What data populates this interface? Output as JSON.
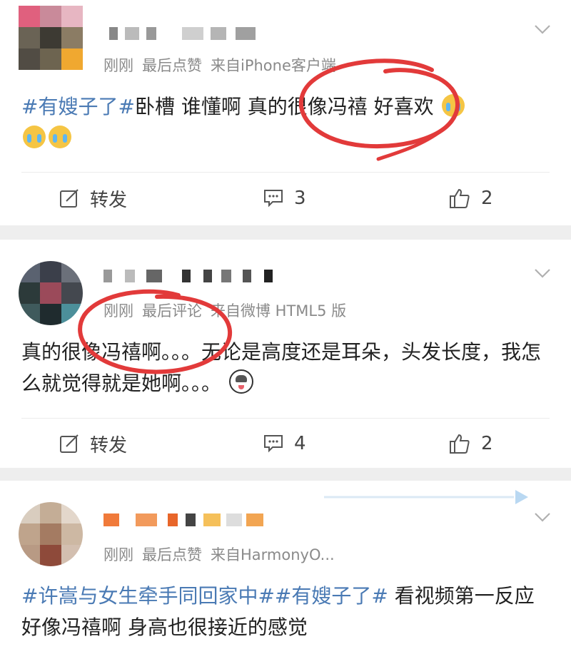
{
  "posts": [
    {
      "meta": {
        "time": "刚刚",
        "liked": "最后点赞",
        "source": "来自iPhone客户端"
      },
      "content": {
        "tag": "#有嫂子了#",
        "text": "卧槽 谁懂啊 真的很像冯禧 好喜欢"
      },
      "actions": {
        "repost": "转发",
        "comments": "3",
        "likes": "2"
      }
    },
    {
      "meta": {
        "time": "刚刚",
        "liked": "最后评论",
        "source": "来自微博 HTML5 版"
      },
      "content": {
        "text": "真的很像冯禧啊。。。无论是高度还是耳朵，头发长度，我怎么就觉得就是她啊。。。"
      },
      "actions": {
        "repost": "转发",
        "comments": "4",
        "likes": "2"
      }
    },
    {
      "meta": {
        "time": "刚刚",
        "liked": "最后点赞",
        "source": "来自HarmonyO..."
      },
      "content": {
        "tag": "#许嵩与女生牵手同回家中##有嫂子了#",
        "text": " 看视频第一反应 好像冯禧啊 身高也很接近的感觉"
      }
    }
  ],
  "icons": {
    "repost": "edit-square-icon",
    "comment": "comment-bubble-icon",
    "like": "thumbs-up-icon",
    "more": "chevron-down-icon"
  },
  "colors": {
    "hashtag": "#4a7ab4",
    "meta": "#8a8a8a",
    "annotation": "#e23a3a",
    "separator": "#eeeeee"
  }
}
